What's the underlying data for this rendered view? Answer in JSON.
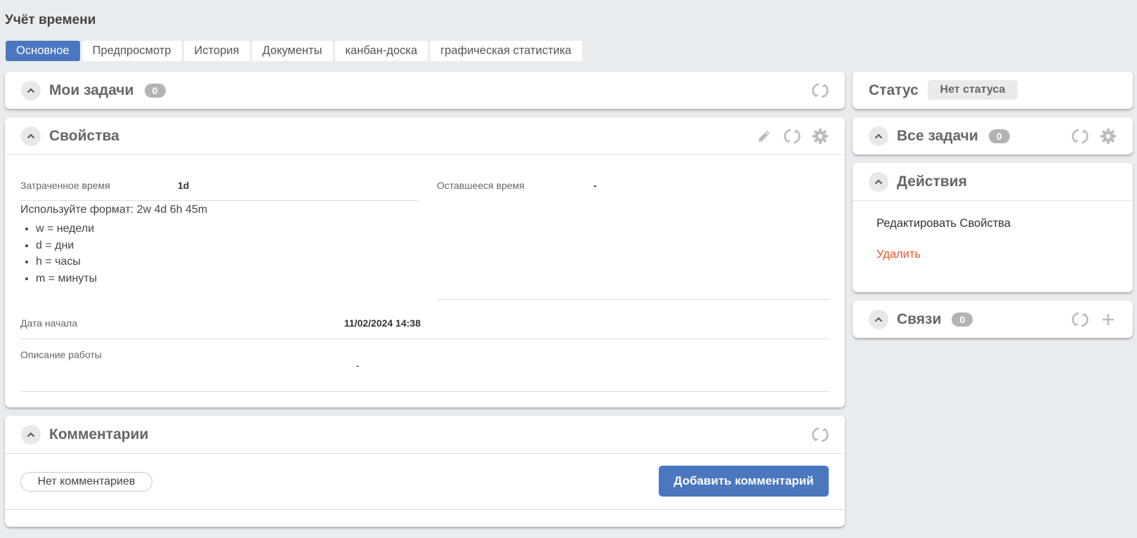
{
  "page": {
    "title": "Учёт времени"
  },
  "tabs": [
    "Основное",
    "Предпросмотр",
    "История",
    "Документы",
    "канбан-доска",
    "графическая статистика"
  ],
  "my_tasks": {
    "title": "Мои задачи",
    "count": "0"
  },
  "properties": {
    "title": "Свойства",
    "spent_label": "Затраченное время",
    "spent_value": "1d",
    "remaining_label": "Оставшееся время",
    "remaining_value": "-",
    "format_hint": "Используйте формат: 2w 4d 6h 45m",
    "format_items": [
      "w = недели",
      "d = дни",
      "h = часы",
      "m = минуты"
    ],
    "start_label": "Дата начала",
    "start_value": "11/02/2024 14:38",
    "description_label": "Описание работы",
    "description_value": "-"
  },
  "comments": {
    "title": "Комментарии",
    "empty_label": "Нет комментариев",
    "add_button": "Добавить комментарий"
  },
  "status": {
    "label": "Статус",
    "value": "Нет статуса"
  },
  "all_tasks": {
    "title": "Все задачи",
    "count": "0"
  },
  "actions": {
    "title": "Действия",
    "edit": "Редактировать Свойства",
    "delete": "Удалить"
  },
  "links": {
    "title": "Связи",
    "count": "0"
  },
  "colors": {
    "accent": "#4a77be",
    "danger": "#e8562a",
    "icon": "#bbbbbb"
  }
}
